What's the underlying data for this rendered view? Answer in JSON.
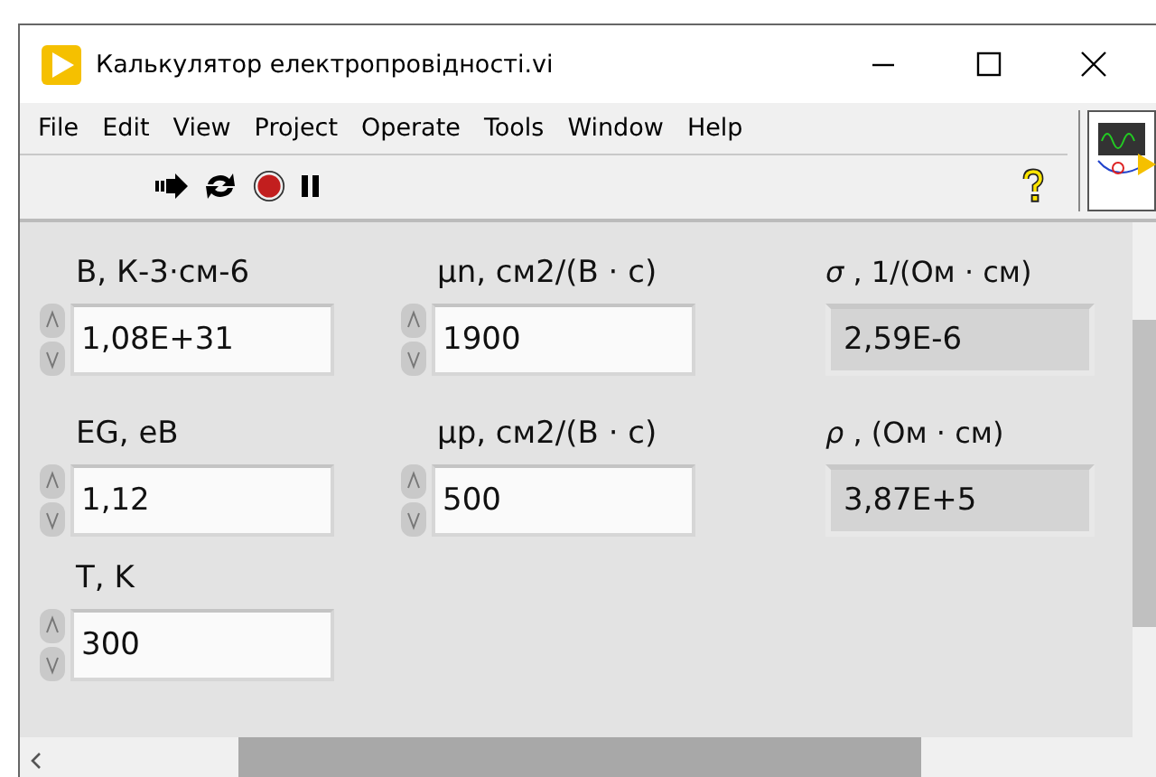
{
  "window": {
    "title": "Калькулятор електропровідності.vi"
  },
  "menu": [
    "File",
    "Edit",
    "View",
    "Project",
    "Operate",
    "Tools",
    "Window",
    "Help"
  ],
  "columns": [
    {
      "controls": [
        {
          "kind": "control",
          "label": "B, К-3·см-6",
          "value": "1,08E+31"
        },
        {
          "kind": "control",
          "label": "EG, еВ",
          "value": "1,12"
        },
        {
          "kind": "control",
          "label": "T, K",
          "value": "300"
        }
      ]
    },
    {
      "controls": [
        {
          "kind": "control",
          "label": "μn, см2/(В · с)",
          "value": "1900"
        },
        {
          "kind": "control",
          "label": "μp, см2/(В · с)",
          "value": "500"
        }
      ]
    },
    {
      "controls": [
        {
          "kind": "indicator",
          "label": "*σ* , 1/(Ом · см)",
          "value": "2,59E-6"
        },
        {
          "kind": "indicator",
          "label": "*ρ* , (Ом · см)",
          "value": "3,87E+5"
        }
      ]
    }
  ]
}
